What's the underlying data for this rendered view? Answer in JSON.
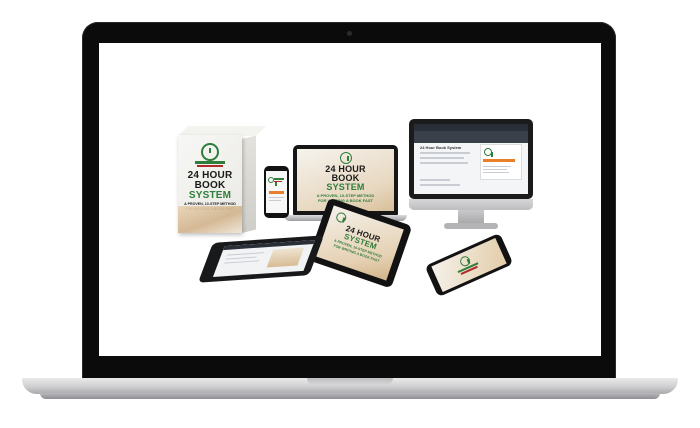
{
  "product": {
    "title_line1": "24 HOUR",
    "title_line2": "BOOK",
    "title_line3": "SYSTEM",
    "tagline_line1": "A PROVEN, 10-STEP METHOD",
    "tagline_line2": "FOR WRITING A BOOK FAST"
  },
  "monitor_page": {
    "header": "24 Hour Book System"
  },
  "colors": {
    "brand_green": "#2f7d3b",
    "brand_red": "#b32a2a",
    "accent_orange": "#e8802a"
  },
  "icons": [
    "clock-icon",
    "book-icon"
  ]
}
